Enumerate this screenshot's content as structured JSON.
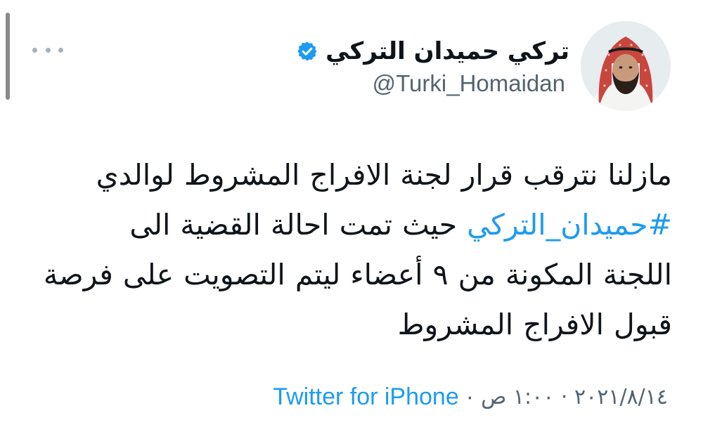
{
  "author": {
    "display_name": "تركي حميدان التركي",
    "handle": "@Turki_Homaidan",
    "verified": true,
    "avatar_icon": "profile-photo-man-red-shemagh"
  },
  "menu": {
    "more_icon": "more-horizontal-icon"
  },
  "tweet": {
    "lines": [
      {
        "text": "مازلنا نترقب قرار لجنة الافراج المشروط لوالدي"
      },
      {
        "hashtag": "#حميدان_التركي",
        "text": " حيث تمت احالة القضية الى"
      },
      {
        "text": "اللجنة المكونة من ٩ أعضاء ليتم التصويت على فرصة"
      },
      {
        "text": "قبول الافراج المشروط"
      }
    ]
  },
  "meta": {
    "time": "١:٠٠ ص",
    "date": "٢٠٢١/٨/١٤",
    "source": "Twitter for iPhone",
    "separator": "·"
  },
  "colors": {
    "link": "#1d9bf0",
    "secondary_text": "#536471",
    "primary_text": "#0f1419"
  }
}
